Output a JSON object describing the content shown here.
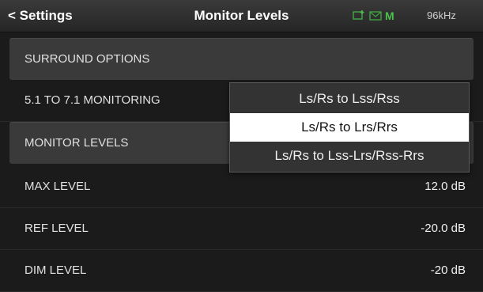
{
  "header": {
    "back_label": "< Settings",
    "title": "Monitor Levels",
    "status": {
      "add_icon": "screen-add-icon",
      "mail_icon": "mail-icon",
      "mode": "M",
      "sample_rate": "96kHz"
    }
  },
  "rows": {
    "surround_options": "SURROUND OPTIONS",
    "monitoring_51_71": "5.1 TO 7.1 MONITORING",
    "monitor_levels": "MONITOR LEVELS",
    "max_level": {
      "label": "MAX LEVEL",
      "value": "12.0 dB"
    },
    "ref_level": {
      "label": "REF LEVEL",
      "value": "-20.0 dB"
    },
    "dim_level": {
      "label": "DIM LEVEL",
      "value": "-20 dB"
    }
  },
  "dropdown": {
    "options": [
      "Ls/Rs to Lss/Rss",
      "Ls/Rs to Lrs/Rrs",
      "Ls/Rs to Lss-Lrs/Rss-Rrs"
    ],
    "selected": "Ls/Rs to Lrs/Rrs"
  },
  "colors": {
    "accent_green": "#4cc24c",
    "selected_bg": "#ffffff"
  }
}
